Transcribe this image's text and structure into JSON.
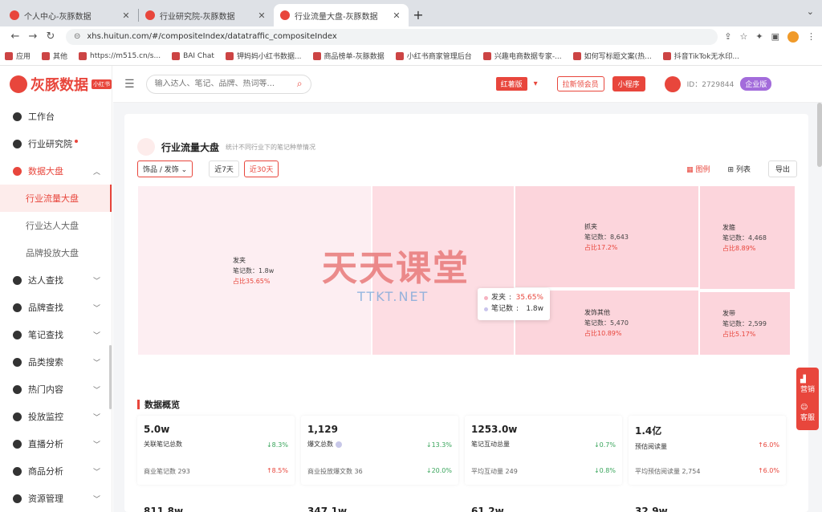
{
  "browser": {
    "tabs": [
      {
        "title": "个人中心-灰豚数据",
        "active": false
      },
      {
        "title": "行业研究院-灰豚数据",
        "active": false
      },
      {
        "title": "行业流量大盘-灰豚数据",
        "active": true
      }
    ],
    "url": "xhs.huitun.com/#/compositeIndex/datatraffic_compositeIndex",
    "bookmarks": [
      "应用",
      "其他",
      "https://m515.cn/s...",
      "BAI Chat",
      "钾妈妈小红书数据...",
      "商品榜单-灰豚数据",
      "小红书商家管理后台",
      "兴趣电商数据专家-...",
      "如何写标题文案(热...",
      "抖音TikTok无水印..."
    ]
  },
  "app": {
    "logo_text": "灰豚数据",
    "logo_tag": "小红书",
    "search_placeholder": "输入达人、笔记、品牌、热词等...",
    "version_label": "红薯版",
    "btn_upgrade": "拉新领会员",
    "btn_miniapp": "小程序",
    "user_id": "ID：2729844",
    "enterprise_label": "企业版"
  },
  "sidebar": {
    "items": [
      {
        "label": "工作台"
      },
      {
        "label": "行业研究院",
        "dot": true
      },
      {
        "label": "数据大盘",
        "open": true
      },
      {
        "label": "达人查找"
      },
      {
        "label": "品牌查找"
      },
      {
        "label": "笔记查找"
      },
      {
        "label": "品类搜索"
      },
      {
        "label": "热门内容"
      },
      {
        "label": "投放监控"
      },
      {
        "label": "直播分析"
      },
      {
        "label": "商品分析"
      },
      {
        "label": "资源管理"
      }
    ],
    "sub_items": [
      {
        "label": "行业流量大盘",
        "active": true
      },
      {
        "label": "行业达人大盘"
      },
      {
        "label": "品牌投放大盘"
      }
    ]
  },
  "page": {
    "title": "行业流量大盘",
    "subtitle": "统计不同行业下的笔记种草情况",
    "category_filter": "饰品 / 发饰",
    "range_7": "近7天",
    "range_30": "近30天",
    "view_chart": "图例",
    "view_list": "列表",
    "export": "导出"
  },
  "chart_data": {
    "type": "treemap",
    "series_label": "笔记数",
    "items": [
      {
        "name": "发夹",
        "notes": "1.8w",
        "pct": "占比35.65%",
        "value": 18000,
        "color": "#fdeef2"
      },
      {
        "name": "",
        "notes": "",
        "pct": "",
        "value": 9500,
        "color": "#fddde3"
      },
      {
        "name": "抓夹",
        "notes": "8,643",
        "pct": "占比17.2%",
        "value": 8643,
        "color": "#fcd5dc"
      },
      {
        "name": "发箍",
        "notes": "4,468",
        "pct": "占比8.89%",
        "value": 4468,
        "color": "#fcd5dc"
      },
      {
        "name": "发饰其他",
        "notes": "5,470",
        "pct": "占比10.89%",
        "value": 5470,
        "color": "#fcd5dc"
      },
      {
        "name": "发带",
        "notes": "2,599",
        "pct": "占比5.17%",
        "value": 2599,
        "color": "#fcd5dc"
      }
    ],
    "tooltip": {
      "name": "发夹",
      "pct": "35.65%",
      "label": "笔记数",
      "notes": "1.8w"
    }
  },
  "watermark": {
    "main": "天天课堂",
    "sub": "TTKT.NET"
  },
  "overview": {
    "title": "数据概览",
    "cards": [
      {
        "value": "5.0w",
        "label": "关联笔记总数",
        "chg1": "↓8.3%",
        "chg1_dir": "down",
        "sub": "商业笔记数  293",
        "chg2": "↑8.5%",
        "chg2_dir": "up"
      },
      {
        "value": "1,129",
        "label": "爆文总数",
        "chg1": "↓13.3%",
        "chg1_dir": "down",
        "sub": "商业投放爆文数  36",
        "chg2": "↓20.0%",
        "chg2_dir": "down"
      },
      {
        "value": "1253.0w",
        "label": "笔记互动总量",
        "chg1": "↓0.7%",
        "chg1_dir": "down",
        "sub": "平均互动量  249",
        "chg2": "↓0.8%",
        "chg2_dir": "down"
      },
      {
        "value": "1.4亿",
        "label": "预估阅读量",
        "chg1": "↑6.0%",
        "chg1_dir": "up",
        "sub": "平均预估阅读量  2,754",
        "chg2": "↑6.0%",
        "chg2_dir": "up"
      }
    ],
    "peek": [
      "811.8w",
      "347.1w",
      "61.2w",
      "32.9w"
    ]
  },
  "float": {
    "marketing": "营销",
    "service": "客服"
  }
}
